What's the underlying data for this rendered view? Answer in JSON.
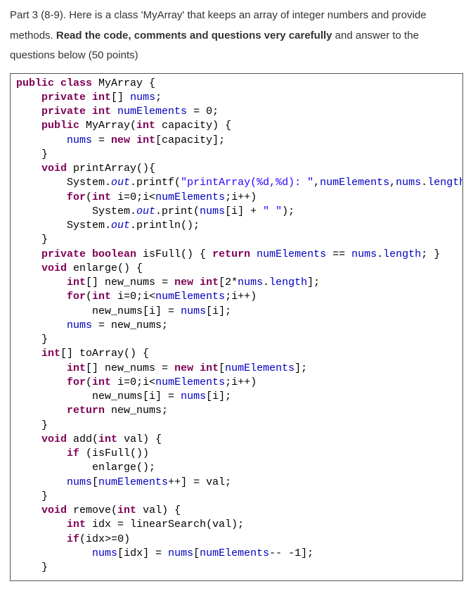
{
  "intro": {
    "line1a": "Part 3 (8-9). Here is a class 'MyArray' that keeps an array of integer numbers and provide",
    "line2a": "methods. ",
    "line2b": "Read the code, comments and questions very carefully",
    "line2c": " and answer to the",
    "line3a": "questions below (50 points)"
  },
  "code": {
    "tokens": [
      {
        "t": "public ",
        "c": "kw"
      },
      {
        "t": "class ",
        "c": "kw"
      },
      {
        "t": "MyArray {",
        "c": "id"
      },
      {
        "t": "\n"
      },
      {
        "t": "    "
      },
      {
        "t": "private ",
        "c": "kw"
      },
      {
        "t": "int",
        "c": "type"
      },
      {
        "t": "[] ",
        "c": "id"
      },
      {
        "t": "nums",
        "c": "field"
      },
      {
        "t": ";",
        "c": "id"
      },
      {
        "t": "\n"
      },
      {
        "t": "    "
      },
      {
        "t": "private ",
        "c": "kw"
      },
      {
        "t": "int ",
        "c": "type"
      },
      {
        "t": "numElements",
        "c": "field"
      },
      {
        "t": " = ",
        "c": "id"
      },
      {
        "t": "0",
        "c": "num"
      },
      {
        "t": ";",
        "c": "id"
      },
      {
        "t": "\n"
      },
      {
        "t": "    "
      },
      {
        "t": "public ",
        "c": "kw"
      },
      {
        "t": "MyArray(",
        "c": "id"
      },
      {
        "t": "int ",
        "c": "type"
      },
      {
        "t": "capacity",
        "c": "id"
      },
      {
        "t": ") {",
        "c": "id"
      },
      {
        "t": "\n"
      },
      {
        "t": "        "
      },
      {
        "t": "nums",
        "c": "field"
      },
      {
        "t": " = ",
        "c": "id"
      },
      {
        "t": "new ",
        "c": "kw"
      },
      {
        "t": "int",
        "c": "type"
      },
      {
        "t": "[",
        "c": "id"
      },
      {
        "t": "capacity",
        "c": "id"
      },
      {
        "t": "];",
        "c": "id"
      },
      {
        "t": "\n"
      },
      {
        "t": "    }",
        "c": "id"
      },
      {
        "t": "\n"
      },
      {
        "t": "    "
      },
      {
        "t": "void ",
        "c": "kw"
      },
      {
        "t": "printArray(){",
        "c": "id"
      },
      {
        "t": "\n"
      },
      {
        "t": "        System.",
        "c": "id"
      },
      {
        "t": "out",
        "c": "it"
      },
      {
        "t": ".printf(",
        "c": "id"
      },
      {
        "t": "\"printArray(%d,%d): \"",
        "c": "str"
      },
      {
        "t": ",",
        "c": "id"
      },
      {
        "t": "numElements",
        "c": "field"
      },
      {
        "t": ",",
        "c": "id"
      },
      {
        "t": "nums",
        "c": "field"
      },
      {
        "t": ".",
        "c": "id"
      },
      {
        "t": "length",
        "c": "field"
      },
      {
        "t": ");",
        "c": "id"
      },
      {
        "t": "\n"
      },
      {
        "t": "        "
      },
      {
        "t": "for",
        "c": "kw"
      },
      {
        "t": "(",
        "c": "id"
      },
      {
        "t": "int ",
        "c": "type"
      },
      {
        "t": "i",
        "c": "id"
      },
      {
        "t": "=",
        "c": "id"
      },
      {
        "t": "0",
        "c": "num"
      },
      {
        "t": ";",
        "c": "id"
      },
      {
        "t": "i",
        "c": "id"
      },
      {
        "t": "<",
        "c": "id"
      },
      {
        "t": "numElements",
        "c": "field"
      },
      {
        "t": ";",
        "c": "id"
      },
      {
        "t": "i",
        "c": "id"
      },
      {
        "t": "++)",
        "c": "id"
      },
      {
        "t": "\n"
      },
      {
        "t": "            System.",
        "c": "id"
      },
      {
        "t": "out",
        "c": "it"
      },
      {
        "t": ".print(",
        "c": "id"
      },
      {
        "t": "nums",
        "c": "field"
      },
      {
        "t": "[",
        "c": "id"
      },
      {
        "t": "i",
        "c": "id"
      },
      {
        "t": "] + ",
        "c": "id"
      },
      {
        "t": "\" \"",
        "c": "str"
      },
      {
        "t": ");",
        "c": "id"
      },
      {
        "t": "\n"
      },
      {
        "t": "        System.",
        "c": "id"
      },
      {
        "t": "out",
        "c": "it"
      },
      {
        "t": ".println();",
        "c": "id"
      },
      {
        "t": "\n"
      },
      {
        "t": "    }",
        "c": "id"
      },
      {
        "t": "\n"
      },
      {
        "t": "    "
      },
      {
        "t": "private ",
        "c": "kw"
      },
      {
        "t": "boolean ",
        "c": "kw"
      },
      {
        "t": "isFull() { ",
        "c": "id"
      },
      {
        "t": "return ",
        "c": "kw"
      },
      {
        "t": "numElements",
        "c": "field"
      },
      {
        "t": " == ",
        "c": "id"
      },
      {
        "t": "nums",
        "c": "field"
      },
      {
        "t": ".",
        "c": "id"
      },
      {
        "t": "length",
        "c": "field"
      },
      {
        "t": "; }",
        "c": "id"
      },
      {
        "t": "\n"
      },
      {
        "t": "    "
      },
      {
        "t": "void ",
        "c": "kw"
      },
      {
        "t": "enlarge() {",
        "c": "id"
      },
      {
        "t": "\n"
      },
      {
        "t": "        "
      },
      {
        "t": "int",
        "c": "type"
      },
      {
        "t": "[] ",
        "c": "id"
      },
      {
        "t": "new_nums",
        "c": "id"
      },
      {
        "t": " = ",
        "c": "id"
      },
      {
        "t": "new ",
        "c": "kw"
      },
      {
        "t": "int",
        "c": "type"
      },
      {
        "t": "[2*",
        "c": "id"
      },
      {
        "t": "nums",
        "c": "field"
      },
      {
        "t": ".",
        "c": "id"
      },
      {
        "t": "length",
        "c": "field"
      },
      {
        "t": "];",
        "c": "id"
      },
      {
        "t": "\n"
      },
      {
        "t": "        "
      },
      {
        "t": "for",
        "c": "kw"
      },
      {
        "t": "(",
        "c": "id"
      },
      {
        "t": "int ",
        "c": "type"
      },
      {
        "t": "i",
        "c": "id"
      },
      {
        "t": "=",
        "c": "id"
      },
      {
        "t": "0",
        "c": "num"
      },
      {
        "t": ";",
        "c": "id"
      },
      {
        "t": "i",
        "c": "id"
      },
      {
        "t": "<",
        "c": "id"
      },
      {
        "t": "numElements",
        "c": "field"
      },
      {
        "t": ";",
        "c": "id"
      },
      {
        "t": "i",
        "c": "id"
      },
      {
        "t": "++)",
        "c": "id"
      },
      {
        "t": "\n"
      },
      {
        "t": "            new_nums[",
        "c": "id"
      },
      {
        "t": "i",
        "c": "id"
      },
      {
        "t": "] = ",
        "c": "id"
      },
      {
        "t": "nums",
        "c": "field"
      },
      {
        "t": "[",
        "c": "id"
      },
      {
        "t": "i",
        "c": "id"
      },
      {
        "t": "];",
        "c": "id"
      },
      {
        "t": "\n"
      },
      {
        "t": "        "
      },
      {
        "t": "nums",
        "c": "field"
      },
      {
        "t": " = new_nums;",
        "c": "id"
      },
      {
        "t": "\n"
      },
      {
        "t": "    }",
        "c": "id"
      },
      {
        "t": "\n"
      },
      {
        "t": "    "
      },
      {
        "t": "int",
        "c": "type"
      },
      {
        "t": "[] toArray() {",
        "c": "id"
      },
      {
        "t": "\n"
      },
      {
        "t": "        "
      },
      {
        "t": "int",
        "c": "type"
      },
      {
        "t": "[] new_nums = ",
        "c": "id"
      },
      {
        "t": "new ",
        "c": "kw"
      },
      {
        "t": "int",
        "c": "type"
      },
      {
        "t": "[",
        "c": "id"
      },
      {
        "t": "numElements",
        "c": "field"
      },
      {
        "t": "];",
        "c": "id"
      },
      {
        "t": "\n"
      },
      {
        "t": "        "
      },
      {
        "t": "for",
        "c": "kw"
      },
      {
        "t": "(",
        "c": "id"
      },
      {
        "t": "int ",
        "c": "type"
      },
      {
        "t": "i",
        "c": "id"
      },
      {
        "t": "=",
        "c": "id"
      },
      {
        "t": "0",
        "c": "num"
      },
      {
        "t": ";",
        "c": "id"
      },
      {
        "t": "i",
        "c": "id"
      },
      {
        "t": "<",
        "c": "id"
      },
      {
        "t": "numElements",
        "c": "field"
      },
      {
        "t": ";",
        "c": "id"
      },
      {
        "t": "i",
        "c": "id"
      },
      {
        "t": "++)",
        "c": "id"
      },
      {
        "t": "\n"
      },
      {
        "t": "            new_nums[",
        "c": "id"
      },
      {
        "t": "i",
        "c": "id"
      },
      {
        "t": "] = ",
        "c": "id"
      },
      {
        "t": "nums",
        "c": "field"
      },
      {
        "t": "[",
        "c": "id"
      },
      {
        "t": "i",
        "c": "id"
      },
      {
        "t": "];",
        "c": "id"
      },
      {
        "t": "\n"
      },
      {
        "t": "        "
      },
      {
        "t": "return ",
        "c": "kw"
      },
      {
        "t": "new_nums;",
        "c": "id"
      },
      {
        "t": "\n"
      },
      {
        "t": "    }",
        "c": "id"
      },
      {
        "t": "\n"
      },
      {
        "t": "    "
      },
      {
        "t": "void ",
        "c": "kw"
      },
      {
        "t": "add(",
        "c": "id"
      },
      {
        "t": "int ",
        "c": "type"
      },
      {
        "t": "val",
        "c": "id"
      },
      {
        "t": ") {",
        "c": "id"
      },
      {
        "t": "\n"
      },
      {
        "t": "        "
      },
      {
        "t": "if ",
        "c": "kw"
      },
      {
        "t": "(isFull())",
        "c": "id"
      },
      {
        "t": "\n"
      },
      {
        "t": "            enlarge();",
        "c": "id"
      },
      {
        "t": "\n"
      },
      {
        "t": "        "
      },
      {
        "t": "nums",
        "c": "field"
      },
      {
        "t": "[",
        "c": "id"
      },
      {
        "t": "numElements",
        "c": "field"
      },
      {
        "t": "++] = ",
        "c": "id"
      },
      {
        "t": "val",
        "c": "id"
      },
      {
        "t": ";",
        "c": "id"
      },
      {
        "t": "\n"
      },
      {
        "t": "    }",
        "c": "id"
      },
      {
        "t": "\n"
      },
      {
        "t": "    "
      },
      {
        "t": "void ",
        "c": "kw"
      },
      {
        "t": "remove(",
        "c": "id"
      },
      {
        "t": "int ",
        "c": "type"
      },
      {
        "t": "val",
        "c": "id"
      },
      {
        "t": ") {",
        "c": "id"
      },
      {
        "t": "\n"
      },
      {
        "t": "        "
      },
      {
        "t": "int ",
        "c": "type"
      },
      {
        "t": "idx",
        "c": "id"
      },
      {
        "t": " = linearSearch(",
        "c": "id"
      },
      {
        "t": "val",
        "c": "id"
      },
      {
        "t": ");",
        "c": "id"
      },
      {
        "t": "\n"
      },
      {
        "t": "        "
      },
      {
        "t": "if",
        "c": "kw"
      },
      {
        "t": "(",
        "c": "id"
      },
      {
        "t": "idx",
        "c": "id"
      },
      {
        "t": ">=",
        "c": "id"
      },
      {
        "t": "0",
        "c": "num"
      },
      {
        "t": ")",
        "c": "id"
      },
      {
        "t": "\n"
      },
      {
        "t": "            "
      },
      {
        "t": "nums",
        "c": "field"
      },
      {
        "t": "[",
        "c": "id"
      },
      {
        "t": "idx",
        "c": "id"
      },
      {
        "t": "] = ",
        "c": "id"
      },
      {
        "t": "nums",
        "c": "field"
      },
      {
        "t": "[",
        "c": "id"
      },
      {
        "t": "numElements",
        "c": "field"
      },
      {
        "t": "-- -1];",
        "c": "id"
      },
      {
        "t": "\n"
      },
      {
        "t": "    }",
        "c": "id"
      }
    ]
  }
}
